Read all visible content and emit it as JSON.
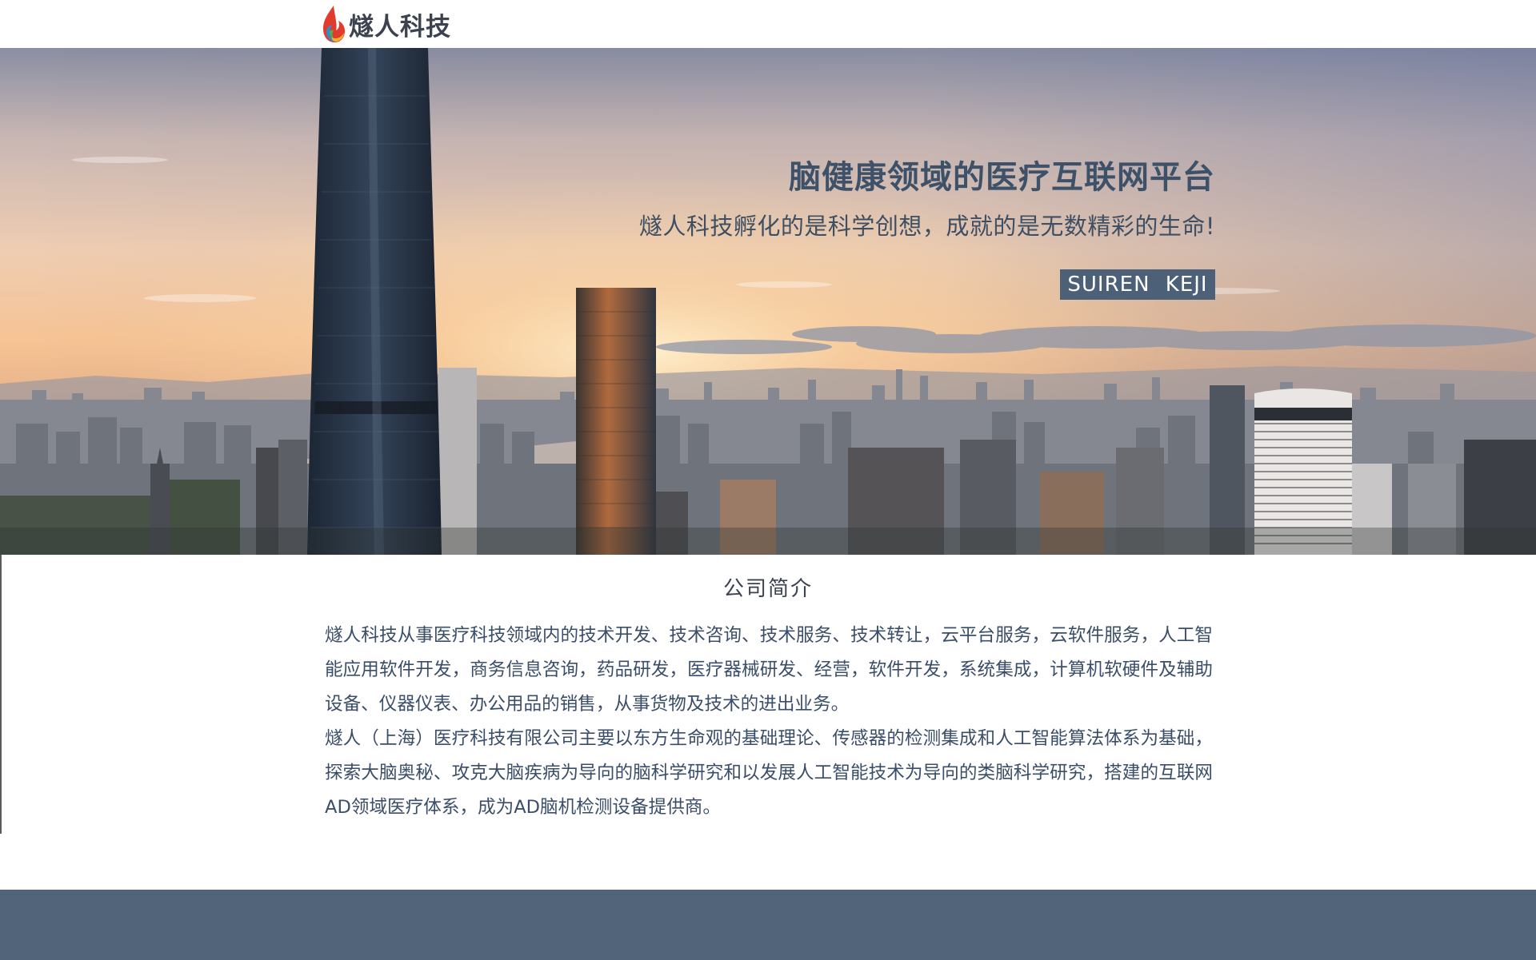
{
  "brand": {
    "name": "燧人科技",
    "logo_icon": "flame-drop-icon"
  },
  "hero": {
    "headline": "脑健康领域的医疗互联网平台",
    "subtitle": "燧人科技孵化的是科学创想，成就的是无数精彩的生命!",
    "badge": "SUIREN KEJI",
    "image": "city-skyline-sunset-image"
  },
  "intro": {
    "title": "公司简介",
    "paragraphs": [
      "燧人科技从事医疗科技领域内的技术开发、技术咨询、技术服务、技术转让，云平台服务，云软件服务，人工智能应用软件开发，商务信息咨询，药品研发，医疗器械研发、经营，软件开发，系统集成，计算机软硬件及辅助设备、仪器仪表、办公用品的销售，从事货物及技术的进出业务。",
      "燧人（上海）医疗科技有限公司主要以东方生命观的基础理论、传感器的检测集成和人工智能算法体系为基础，探索大脑奥秘、攻克大脑疾病为导向的脑科学研究和以发展人工智能技术为导向的类脑科学研究，搭建的互联网AD领域医疗体系，成为AD脑机检测设备提供商。"
    ]
  },
  "colors": {
    "headline": "#3d5269",
    "badge_bg": "#4c6178",
    "body_text": "#3b4e69",
    "footer_bg": "#526479"
  }
}
